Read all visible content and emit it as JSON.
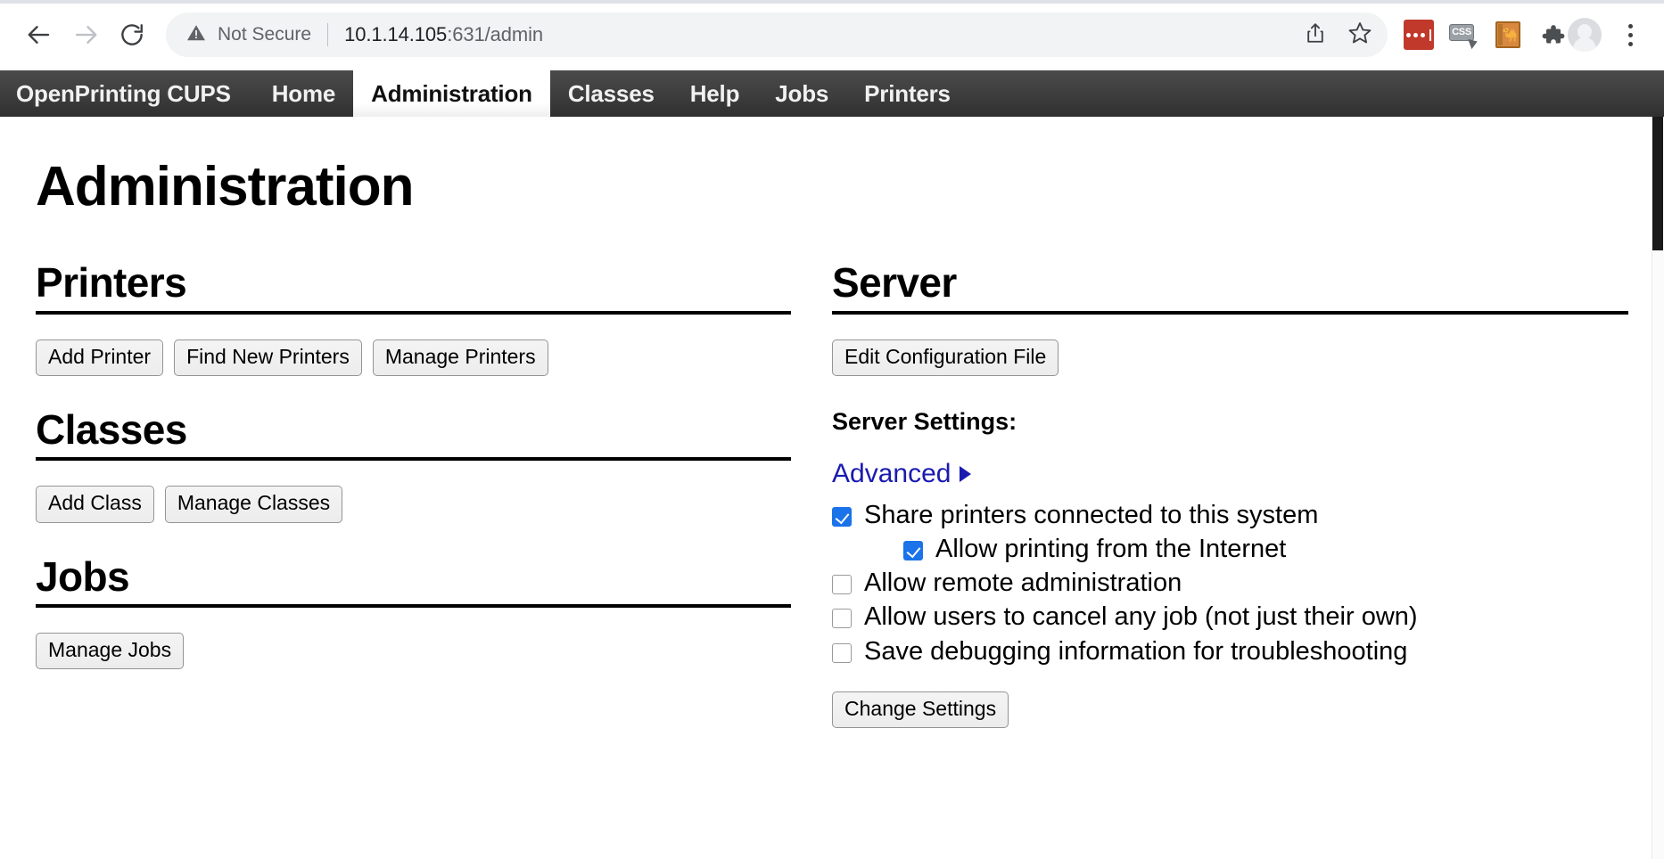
{
  "browser": {
    "back_icon": "arrow-left-icon",
    "forward_icon": "arrow-right-icon",
    "reload_icon": "reload-icon",
    "security_label": "Not Secure",
    "security_icon": "warning-triangle-icon",
    "url_host": "10.1.14.105",
    "url_path": ":631/admin",
    "url_full": "10.1.14.105:631/admin",
    "share_icon": "share-icon",
    "bookmark_icon": "star-icon",
    "extensions": [
      {
        "name": "lastpass-extension-icon",
        "label": "",
        "color": "#c0392b"
      },
      {
        "name": "css-extension-icon",
        "label": "CSS"
      },
      {
        "name": "perl-camel-extension-icon",
        "label": ""
      },
      {
        "name": "extensions-puzzle-icon",
        "label": ""
      }
    ],
    "avatar_icon": "avatar-icon",
    "menu_icon": "three-dot-menu-icon"
  },
  "cups_nav": {
    "brand": "OpenPrinting CUPS",
    "items": [
      {
        "label": "Home",
        "active": false
      },
      {
        "label": "Administration",
        "active": true
      },
      {
        "label": "Classes",
        "active": false
      },
      {
        "label": "Help",
        "active": false
      },
      {
        "label": "Jobs",
        "active": false
      },
      {
        "label": "Printers",
        "active": false
      }
    ]
  },
  "page": {
    "title": "Administration",
    "left_column": {
      "printers": {
        "heading": "Printers",
        "buttons": [
          {
            "label": "Add Printer"
          },
          {
            "label": "Find New Printers"
          },
          {
            "label": "Manage Printers"
          }
        ]
      },
      "classes": {
        "heading": "Classes",
        "buttons": [
          {
            "label": "Add Class"
          },
          {
            "label": "Manage Classes"
          }
        ]
      },
      "jobs": {
        "heading": "Jobs",
        "buttons": [
          {
            "label": "Manage Jobs"
          }
        ]
      }
    },
    "right_column": {
      "server": {
        "heading": "Server",
        "buttons": [
          {
            "label": "Edit Configuration File"
          }
        ],
        "settings_heading": "Server Settings:",
        "advanced_link": "Advanced",
        "advanced_caret": "triangle-right-icon",
        "settings": [
          {
            "label": "Share printers connected to this system",
            "checked": true,
            "indent": false
          },
          {
            "label": "Allow printing from the Internet",
            "checked": true,
            "indent": true
          },
          {
            "label": "Allow remote administration",
            "checked": false,
            "indent": false
          },
          {
            "label": "Allow users to cancel any job (not just their own)",
            "checked": false,
            "indent": false
          },
          {
            "label": "Save debugging information for troubleshooting",
            "checked": false,
            "indent": false
          }
        ],
        "change_settings_label": "Change Settings"
      }
    }
  },
  "colors": {
    "nav_bar_dark": "#3d3d3d",
    "link_blue": "#1a1ab0",
    "checkbox_blue": "#1a73e8",
    "omnibox_bg": "#f1f3f4",
    "text_muted": "#5f6368"
  },
  "scrollbar": {
    "thumb_position_pct": 0,
    "visible": true
  }
}
